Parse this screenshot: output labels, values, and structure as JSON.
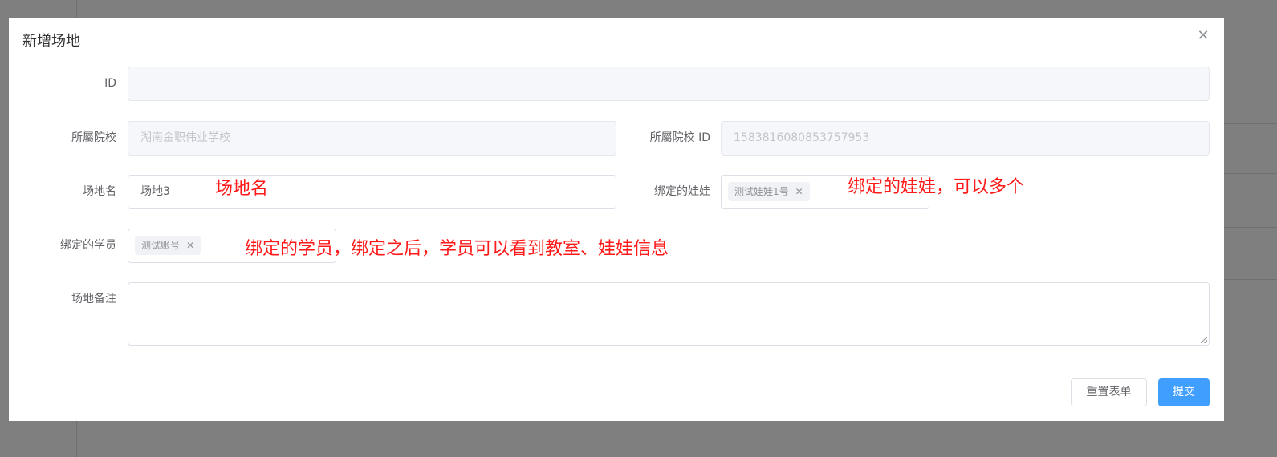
{
  "dialog": {
    "title": "新增场地",
    "close_icon": "close-icon"
  },
  "fields": {
    "id": {
      "label": "ID",
      "value": ""
    },
    "school": {
      "label": "所屬院校",
      "value": "湖南金职伟业学校"
    },
    "school_id": {
      "label": "所屬院校 ID",
      "value": "1583816080853757953"
    },
    "venue_name": {
      "label": "场地名",
      "value": "场地3"
    },
    "bound_dolls": {
      "label": "绑定的娃娃",
      "tags": [
        "测试娃娃1号"
      ]
    },
    "bound_students": {
      "label": "绑定的学员",
      "tags": [
        "测试账号"
      ]
    },
    "remark": {
      "label": "场地备注",
      "value": ""
    }
  },
  "annotations": {
    "venue_name": "场地名",
    "bound_dolls": "绑定的娃娃，可以多个",
    "bound_students": "绑定的学员，绑定之后，学员可以看到教室、娃娃信息"
  },
  "buttons": {
    "reset": "重置表单",
    "submit": "提交"
  },
  "colors": {
    "primary": "#409eff",
    "annotation": "#ff1a1a",
    "overlay": "#7f7f7f"
  }
}
